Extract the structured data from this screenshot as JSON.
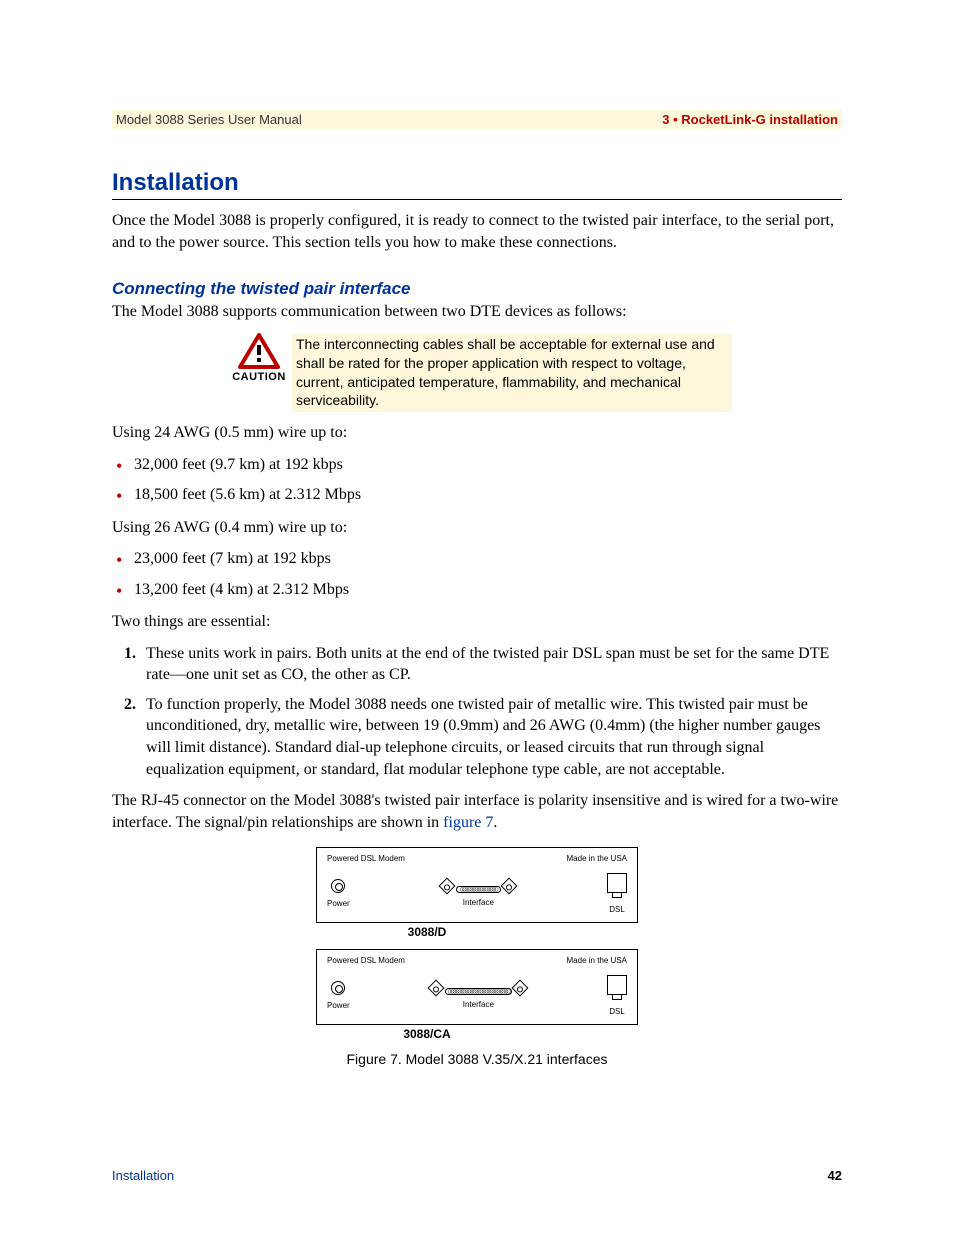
{
  "header": {
    "left": "Model 3088 Series User Manual",
    "right": "3 • RocketLink-G installation"
  },
  "h1": "Installation",
  "intro": "Once the Model 3088 is properly configured, it is ready to connect to the twisted pair interface, to the serial port, and to the power source. This section tells you how to make these connections.",
  "h2": "Connecting the twisted pair interface",
  "subintro": "The Model 3088 supports communication between two DTE devices as follows:",
  "caution": {
    "label": "CAUTION",
    "text": "The interconnecting cables shall be acceptable for external use and shall be rated for the proper application with respect to voltage, current, anticipated temperature, flammability, and mechanical serviceability."
  },
  "wire24_intro": "Using 24 AWG (0.5 mm) wire up to:",
  "wire24": [
    "32,000 feet (9.7 km) at 192 kbps",
    "18,500 feet (5.6 km) at 2.312 Mbps"
  ],
  "wire26_intro": "Using 26 AWG (0.4 mm) wire up to:",
  "wire26": [
    "23,000 feet (7 km) at 192 kbps",
    "13,200 feet (4 km) at 2.312 Mbps"
  ],
  "essentials_intro": "Two things are essential:",
  "essentials": [
    "These units work in pairs. Both units at the end of the twisted pair DSL span must be set for the same DTE rate—one unit set as CO, the other as CP.",
    "To function properly, the Model 3088 needs one twisted pair of metallic wire. This twisted pair must be unconditioned, dry, metallic wire, between 19 (0.9mm) and 26 AWG (0.4mm) (the higher number gauges will limit distance). Standard dial-up telephone circuits, or leased circuits that run through signal equalization equipment, or standard, flat modular telephone type cable, are not acceptable."
  ],
  "rj45_para_a": "The RJ-45 connector on the Model 3088's twisted pair interface is polarity insensitive and is wired for a two-wire interface. The signal/pin relationships are shown in ",
  "rj45_figref": "figure 7",
  "rj45_para_b": ".",
  "device": {
    "top_left": "Powered DSL Modem",
    "top_right": "Made in the USA",
    "power_label": "Power",
    "interface_label": "Interface",
    "dsl_label": "DSL",
    "model_a": "3088/D",
    "model_b": "3088/CA"
  },
  "fig_caption": "Figure 7. Model 3088 V.35/X.21 interfaces",
  "footer": {
    "left": "Installation",
    "right": "42"
  }
}
